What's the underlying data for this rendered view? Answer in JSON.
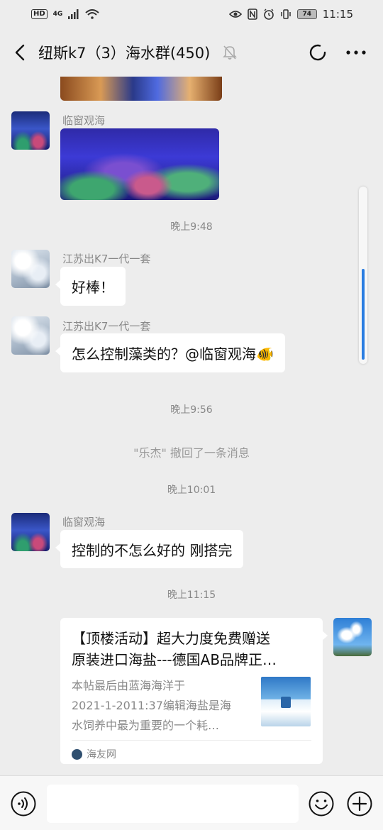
{
  "status_bar": {
    "network_tags": [
      "HD",
      "4G"
    ],
    "time": "11:15",
    "battery": "74"
  },
  "header": {
    "title": "纽斯k7（3）海水群(450)"
  },
  "messages": [
    {
      "sender": "临窗观海",
      "type": "image"
    },
    {
      "time": "晚上9:48"
    },
    {
      "sender": "江苏出K7一代一套",
      "text": "好棒！"
    },
    {
      "sender": "江苏出K7一代一套",
      "text": "怎么控制藻类的？@临窗观海🐠"
    },
    {
      "time": "晚上9:56"
    },
    {
      "recall": "\"乐杰\" 撤回了一条消息"
    },
    {
      "time": "晚上10:01"
    },
    {
      "sender": "临窗观海",
      "text": "控制的不怎么好的 刚搭完"
    },
    {
      "time": "晚上11:15"
    }
  ],
  "link_card": {
    "title_line1": "【顶楼活动】超大力度免费赠送",
    "title_line2": "原装进口海盐---德国AB品牌正…",
    "desc_line1": "本帖最后由蓝海海洋于",
    "desc_line2": "2021-1-2011:37编辑海盐是海",
    "desc_line3": "水饲养中最为重要的一个耗…",
    "source": "海友网"
  },
  "input_bar": {
    "placeholder": ""
  },
  "colors": {
    "background": "#ededed",
    "bubble": "#ffffff",
    "scroll_accent": "#2a7de1"
  }
}
